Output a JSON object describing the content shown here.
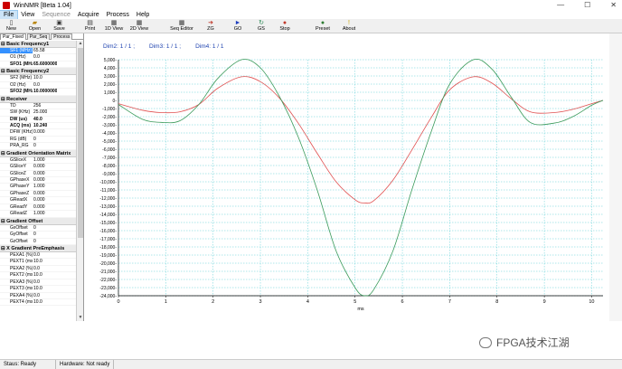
{
  "window": {
    "title": "WinNMR [Beta 1.04]"
  },
  "menu": [
    {
      "label": "File",
      "active": true,
      "disabled": false
    },
    {
      "label": "View",
      "active": false,
      "disabled": false
    },
    {
      "label": "Sequence",
      "active": false,
      "disabled": true
    },
    {
      "label": "Acquire",
      "active": false,
      "disabled": false
    },
    {
      "label": "Process",
      "active": false,
      "disabled": false
    },
    {
      "label": "Help",
      "active": false,
      "disabled": false
    }
  ],
  "toolbar": [
    {
      "label": "New",
      "icon": "new-file-icon",
      "glyph": "▯",
      "color": "#333"
    },
    {
      "label": "Open",
      "icon": "open-folder-icon",
      "glyph": "▰",
      "color": "#b8860b"
    },
    {
      "label": "Save",
      "icon": "save-disk-icon",
      "glyph": "▣",
      "color": "#333"
    },
    {
      "label": "Print",
      "icon": "printer-icon",
      "glyph": "▤",
      "color": "#333"
    },
    {
      "label": "1D View",
      "icon": "1d-view-icon",
      "glyph": "▦",
      "color": "#333"
    },
    {
      "label": "2D View",
      "icon": "2d-view-icon",
      "glyph": "▦",
      "color": "#333"
    },
    {
      "label": "Seq Editor",
      "icon": "seq-editor-icon",
      "glyph": "▦",
      "color": "#333"
    },
    {
      "label": "ZG",
      "icon": "zg-icon",
      "glyph": "➜",
      "color": "#c0392b"
    },
    {
      "label": "GO",
      "icon": "go-icon",
      "glyph": "►",
      "color": "#1f3fbf"
    },
    {
      "label": "GS",
      "icon": "gs-icon",
      "glyph": "↻",
      "color": "#2e8b57"
    },
    {
      "label": "Stop",
      "icon": "stop-icon",
      "glyph": "●",
      "color": "#c0392b"
    },
    {
      "label": "Preset",
      "icon": "preset-icon",
      "glyph": "●",
      "color": "#2e7d32"
    },
    {
      "label": "About",
      "icon": "about-icon",
      "glyph": "!",
      "color": "#c9a400"
    }
  ],
  "left_tabs": [
    "Par_Fixed",
    "Par_Seq",
    "Process"
  ],
  "param_sections": [
    {
      "title": "Basic Frequency1",
      "rows": [
        {
          "name": "SF1 (MHz)",
          "value": "65.58",
          "bold": false,
          "selected": true
        },
        {
          "name": "O1 (Hz)",
          "value": "0.0",
          "bold": false,
          "selected": false
        },
        {
          "name": "SFO1 (MHz)",
          "value": "65.6000000",
          "bold": true,
          "selected": false
        }
      ]
    },
    {
      "title": "Basic Frequency2",
      "rows": [
        {
          "name": "SF2 (MHz)",
          "value": "10.0",
          "bold": false,
          "selected": false
        },
        {
          "name": "O2 (Hz)",
          "value": "0.0",
          "bold": false,
          "selected": false
        },
        {
          "name": "SFO2 (MHz)",
          "value": "10.0000000",
          "bold": true,
          "selected": false
        }
      ]
    },
    {
      "title": "Receiver",
      "rows": [
        {
          "name": "TD",
          "value": "256",
          "bold": false,
          "selected": false
        },
        {
          "name": "SW (KHz)",
          "value": "25.000",
          "bold": false,
          "selected": false
        },
        {
          "name": "DW (us)",
          "value": "40.0",
          "bold": true,
          "selected": false
        },
        {
          "name": "ACQ (ms)",
          "value": "10.240",
          "bold": true,
          "selected": false
        },
        {
          "name": "DFW (KHz)",
          "value": "0.000",
          "bold": false,
          "selected": false
        },
        {
          "name": "RG (dB)",
          "value": "0",
          "bold": false,
          "selected": false
        },
        {
          "name": "PRA_RG",
          "value": "0",
          "bold": false,
          "selected": false
        }
      ]
    },
    {
      "title": "Gradient Orientation Matrix",
      "rows": [
        {
          "name": "GSliceX",
          "value": "1.000",
          "bold": false,
          "selected": false
        },
        {
          "name": "GSliceY",
          "value": "0.000",
          "bold": false,
          "selected": false
        },
        {
          "name": "GSliceZ",
          "value": "0.000",
          "bold": false,
          "selected": false
        },
        {
          "name": "GPhaseX",
          "value": "0.000",
          "bold": false,
          "selected": false
        },
        {
          "name": "GPhaseY",
          "value": "1.000",
          "bold": false,
          "selected": false
        },
        {
          "name": "GPhaseZ",
          "value": "0.000",
          "bold": false,
          "selected": false
        },
        {
          "name": "GReadX",
          "value": "0.000",
          "bold": false,
          "selected": false
        },
        {
          "name": "GReadY",
          "value": "0.000",
          "bold": false,
          "selected": false
        },
        {
          "name": "GReadZ",
          "value": "1.000",
          "bold": false,
          "selected": false
        }
      ]
    },
    {
      "title": "Gradient Offset",
      "rows": [
        {
          "name": "GxOffset",
          "value": "0",
          "bold": false,
          "selected": false
        },
        {
          "name": "GyOffset",
          "value": "0",
          "bold": false,
          "selected": false
        },
        {
          "name": "GzOffset",
          "value": "0",
          "bold": false,
          "selected": false
        }
      ]
    },
    {
      "title": "X Gradient PreEmphasis",
      "rows": [
        {
          "name": "PEXA1 (%)",
          "value": "0.0",
          "bold": false,
          "selected": false
        },
        {
          "name": "PEXT1 (ms)",
          "value": "10.0",
          "bold": false,
          "selected": false
        },
        {
          "name": "PEXA2 (%)",
          "value": "0.0",
          "bold": false,
          "selected": false
        },
        {
          "name": "PEXT2 (ms)",
          "value": "10.0",
          "bold": false,
          "selected": false
        },
        {
          "name": "PEXA3 (%)",
          "value": "0.0",
          "bold": false,
          "selected": false
        },
        {
          "name": "PEXT3 (ms)",
          "value": "10.0",
          "bold": false,
          "selected": false
        },
        {
          "name": "PEXA4 (%)",
          "value": "0.0",
          "bold": false,
          "selected": false
        },
        {
          "name": "PEXT4 (ms)",
          "value": "10.0",
          "bold": false,
          "selected": false
        }
      ]
    }
  ],
  "plot": {
    "dims": [
      "Dim2: 1 / 1 ;",
      "Dim3: 1 / 1 ;",
      "Dim4: 1 / 1"
    ],
    "grid_color": "#5ecfd6",
    "tick_color": "#000000"
  },
  "chart_data": {
    "type": "line",
    "xlabel": "ms",
    "xlim": [
      0,
      10.24
    ],
    "ylim": [
      -24000,
      5000
    ],
    "xticks": [
      0,
      1,
      2,
      3,
      4,
      5,
      6,
      7,
      8,
      9,
      10
    ],
    "yticks": [
      5000,
      4000,
      3000,
      2000,
      1000,
      0,
      -1000,
      -2000,
      -3000,
      -4000,
      -5000,
      -6000,
      -7000,
      -8000,
      -9000,
      -10000,
      -11000,
      -12000,
      -13000,
      -14000,
      -15000,
      -16000,
      -17000,
      -18000,
      -19000,
      -20000,
      -21000,
      -22000,
      -23000,
      -24000
    ],
    "ytick_labels": [
      "5,000-",
      "4,000-",
      "3,000-",
      "2,000-",
      "1,000-",
      "0-",
      "-1,000-",
      "-2,000-",
      "-3,000-",
      "-4,000-",
      "-5,000-",
      "-6,000-",
      "-7,000-",
      "-8,000-",
      "-9,000-",
      "-10,000-",
      "-11,000-",
      "-12,000-",
      "-13,000-",
      "-14,000-",
      "-15,000-",
      "-16,000-",
      "-17,000-",
      "-18,000-",
      "-19,000-",
      "-20,000-",
      "-21,000-",
      "-22,000-",
      "-23,000-",
      "-24,000-"
    ],
    "grid": true,
    "series": [
      {
        "color": "#e05050",
        "x": [
          0,
          0.5,
          0.9,
          1.3,
          1.7,
          2.1,
          2.6,
          3.0,
          3.4,
          3.8,
          4.2,
          4.6,
          5.0,
          5.2,
          5.4,
          5.8,
          6.2,
          6.6,
          7.0,
          7.5,
          7.9,
          8.3,
          8.7,
          9.2,
          9.6,
          10.0,
          10.24
        ],
        "y": [
          -400,
          -1200,
          -1500,
          -1400,
          -500,
          1500,
          2900,
          2300,
          300,
          -2800,
          -6500,
          -10000,
          -12200,
          -12600,
          -12300,
          -9800,
          -6100,
          -2200,
          1300,
          2900,
          2100,
          200,
          -1400,
          -1500,
          -1100,
          -400,
          0
        ]
      },
      {
        "color": "#3a9a5a",
        "x": [
          0,
          0.5,
          0.9,
          1.3,
          1.7,
          2.1,
          2.6,
          3.0,
          3.4,
          3.8,
          4.2,
          4.6,
          5.0,
          5.2,
          5.4,
          5.8,
          6.2,
          6.6,
          7.0,
          7.5,
          7.9,
          8.3,
          8.7,
          9.2,
          9.6,
          10.0,
          10.24
        ],
        "y": [
          -500,
          -2300,
          -2700,
          -2500,
          -500,
          2700,
          5000,
          4000,
          500,
          -4500,
          -11000,
          -18500,
          -23000,
          -24000,
          -23200,
          -18500,
          -11000,
          -4000,
          2000,
          5000,
          3800,
          400,
          -2700,
          -2800,
          -2000,
          -600,
          0
        ]
      }
    ]
  },
  "status": {
    "left": "Staus: Ready",
    "right": "Hardware: Not ready"
  },
  "watermark": {
    "text": "FPGA技术江湖"
  }
}
